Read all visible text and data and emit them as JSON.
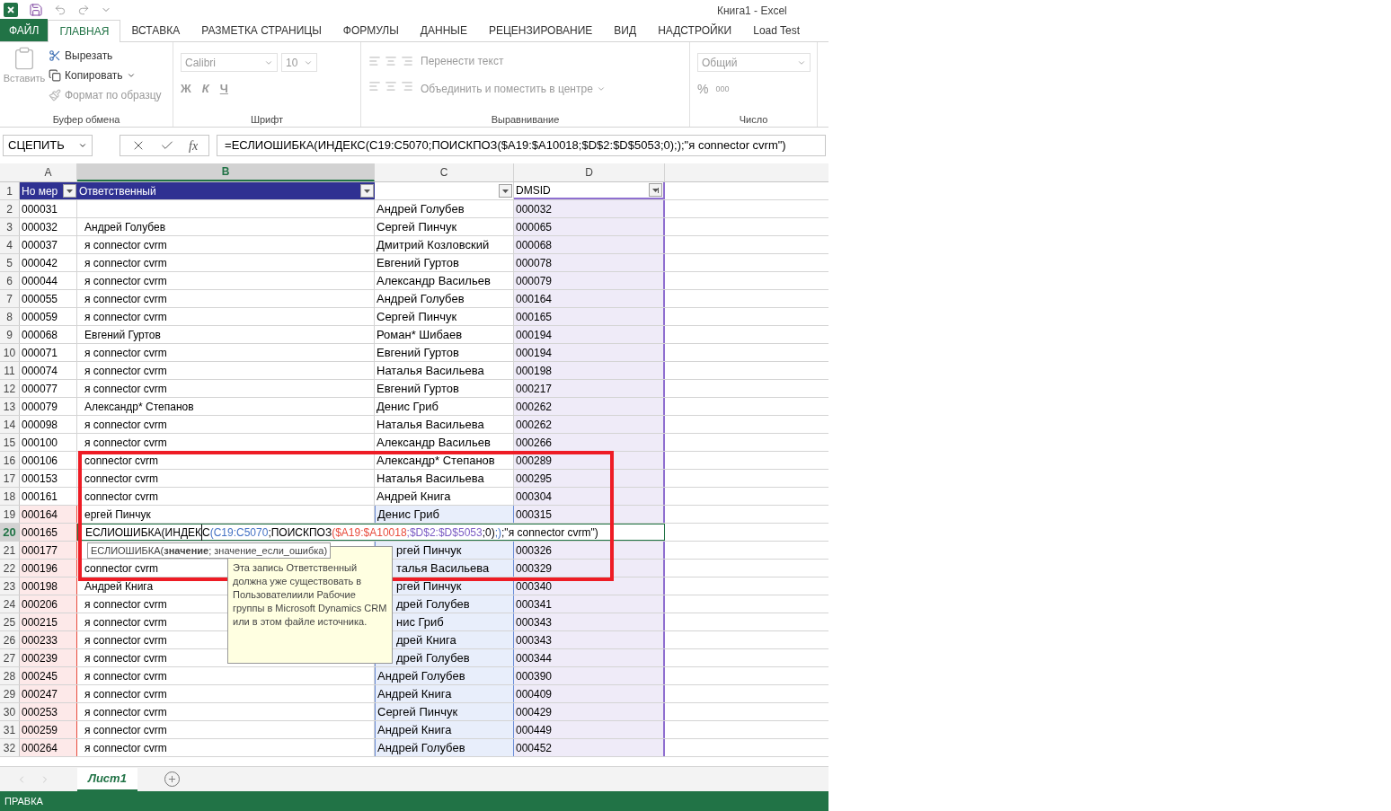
{
  "window": {
    "title": "Книга1 - Excel"
  },
  "tabs": [
    {
      "label": "ФАЙЛ",
      "kind": "file",
      "selected": false
    },
    {
      "label": "ГЛАВНАЯ",
      "kind": "tab",
      "selected": true
    },
    {
      "label": "ВСТАВКА",
      "kind": "tab",
      "selected": false
    },
    {
      "label": "РАЗМЕТКА СТРАНИЦЫ",
      "kind": "tab",
      "selected": false
    },
    {
      "label": "ФОРМУЛЫ",
      "kind": "tab",
      "selected": false
    },
    {
      "label": "ДАННЫЕ",
      "kind": "tab",
      "selected": false
    },
    {
      "label": "РЕЦЕНЗИРОВАНИЕ",
      "kind": "tab",
      "selected": false
    },
    {
      "label": "ВИД",
      "kind": "tab",
      "selected": false
    },
    {
      "label": "НАДСТРОЙКИ",
      "kind": "tab",
      "selected": false
    },
    {
      "label": "Load Test",
      "kind": "tab",
      "selected": false
    }
  ],
  "ribbon": {
    "disabled": true,
    "clipboard": {
      "paste": "Вставить",
      "cut": "Вырезать",
      "copy": "Копировать",
      "format_painter": "Формат по образцу",
      "label": "Буфер обмена"
    },
    "font": {
      "name": "Calibri",
      "size": "10",
      "bold": "Ж",
      "italic": "К",
      "underline": "Ч",
      "label": "Шрифт"
    },
    "alignment": {
      "wrap": "Перенести текст",
      "merge": "Объединить и поместить в центре",
      "label": "Выравнивание"
    },
    "number": {
      "format": "Общий",
      "percent": "%",
      "thousands": "000",
      "label": "Число"
    }
  },
  "formula_bar": {
    "name_box": "СЦЕПИТЬ",
    "fx": "fx",
    "formula": "=ЕСЛИОШИБКА(ИНДЕКС(C19:C5070;ПОИСКПОЗ($A19:$A10018;$D$2:$D$5053;0););\"я connector cvrm\")"
  },
  "columns": [
    {
      "label": "A",
      "selected": false
    },
    {
      "label": "B",
      "selected": true
    },
    {
      "label": "C",
      "selected": false
    },
    {
      "label": "D",
      "selected": false
    }
  ],
  "header_row": {
    "num": "1",
    "a": "Но мер",
    "b": "Ответственный",
    "d": "DMSID"
  },
  "rows": [
    {
      "num": "2",
      "a": "000031",
      "b": "",
      "c": "Андрей Голубев",
      "d": "000032",
      "a_ref": false,
      "c_ref": false,
      "d_ref": true
    },
    {
      "num": "3",
      "a": "000032",
      "b": "Андрей Голубев",
      "c": "Сергей Пинчук",
      "d": "000065",
      "a_ref": false,
      "c_ref": false,
      "d_ref": true
    },
    {
      "num": "4",
      "a": "000037",
      "b": "я connector cvrm",
      "c": "Дмитрий Козловский",
      "d": "000068",
      "a_ref": false,
      "c_ref": false,
      "d_ref": true
    },
    {
      "num": "5",
      "a": "000042",
      "b": "я connector cvrm",
      "c": "Евгений Гуртов",
      "d": "000078",
      "a_ref": false,
      "c_ref": false,
      "d_ref": true
    },
    {
      "num": "6",
      "a": "000044",
      "b": "я connector cvrm",
      "c": "Александр Васильев",
      "d": "000079",
      "a_ref": false,
      "c_ref": false,
      "d_ref": true
    },
    {
      "num": "7",
      "a": "000055",
      "b": "я connector cvrm",
      "c": "Андрей Голубев",
      "d": "000164",
      "a_ref": false,
      "c_ref": false,
      "d_ref": true
    },
    {
      "num": "8",
      "a": "000059",
      "b": "я connector cvrm",
      "c": "Сергей Пинчук",
      "d": "000165",
      "a_ref": false,
      "c_ref": false,
      "d_ref": true
    },
    {
      "num": "9",
      "a": "000068",
      "b": "Евгений Гуртов",
      "c": "Роман* Шибаев",
      "d": "000194",
      "a_ref": false,
      "c_ref": false,
      "d_ref": true
    },
    {
      "num": "10",
      "a": "000071",
      "b": "я connector cvrm",
      "c": "Евгений Гуртов",
      "d": "000194",
      "a_ref": false,
      "c_ref": false,
      "d_ref": true
    },
    {
      "num": "11",
      "a": "000074",
      "b": "я connector cvrm",
      "c": "Наталья Васильева",
      "d": "000198",
      "a_ref": false,
      "c_ref": false,
      "d_ref": true
    },
    {
      "num": "12",
      "a": "000077",
      "b": "я connector cvrm",
      "c": "Евгений Гуртов",
      "d": "000217",
      "a_ref": false,
      "c_ref": false,
      "d_ref": true
    },
    {
      "num": "13",
      "a": "000079",
      "b": "Александр* Степанов",
      "c": "Денис Гриб",
      "d": "000262",
      "a_ref": false,
      "c_ref": false,
      "d_ref": true
    },
    {
      "num": "14",
      "a": "000098",
      "b": "я connector cvrm",
      "c": "Наталья Васильева",
      "d": "000262",
      "a_ref": false,
      "c_ref": false,
      "d_ref": true
    },
    {
      "num": "15",
      "a": "000100",
      "b": "я connector cvrm",
      "c": "Александр Васильев",
      "d": "000266",
      "a_ref": false,
      "c_ref": false,
      "d_ref": true
    },
    {
      "num": "16",
      "a": "000106",
      "b": "connector cvrm",
      "c": "Александр* Степанов",
      "d": "000289",
      "a_ref": false,
      "c_ref": false,
      "d_ref": true
    },
    {
      "num": "17",
      "a": "000153",
      "b": "connector cvrm",
      "c": "Наталья Васильева",
      "d": "000295",
      "a_ref": false,
      "c_ref": false,
      "d_ref": true
    },
    {
      "num": "18",
      "a": "000161",
      "b": "connector cvrm",
      "c": "Андрей Книга",
      "d": "000304",
      "a_ref": false,
      "c_ref": false,
      "d_ref": true
    },
    {
      "num": "19",
      "a": "000164",
      "b": "ергей Пинчук",
      "c": "Денис Гриб",
      "d": "000315",
      "a_ref": true,
      "c_ref": true,
      "d_ref": true
    },
    {
      "num": "20",
      "kind": "editing",
      "a": "000165",
      "a_ref": true,
      "segments": [
        {
          "text": "ЕСЛИОШИБКА(ИНДЕК",
          "color": "#000000"
        },
        {
          "text": "С",
          "color": "#000000"
        },
        {
          "text": "(C19:C5070",
          "color": "#4472c4"
        },
        {
          "text": ";ПОИСКПОЗ",
          "color": "#000000"
        },
        {
          "text": "($A19:$A10018",
          "color": "#e84c3d"
        },
        {
          "text": ";$D$2:$D$5053",
          "color": "#7b5cc4"
        },
        {
          "text": ";0)",
          "color": "#000000"
        },
        {
          "text": ";)",
          "color": "#4472c4"
        },
        {
          "text": ";\"я connector cvrm\")",
          "color": "#000000"
        }
      ]
    },
    {
      "num": "21",
      "a": "000177",
      "b": "",
      "c": "ргей Пинчук",
      "d": "000326",
      "a_ref": true,
      "c_ref": true,
      "d_ref": true,
      "c_partly_hidden": true
    },
    {
      "num": "22",
      "a": "000196",
      "b": "connector cvrm",
      "c": "талья Васильева",
      "d": "000329",
      "a_ref": true,
      "c_ref": true,
      "d_ref": true,
      "c_partly_hidden": true
    },
    {
      "num": "23",
      "a": "000198",
      "b": "Андрей Книга",
      "c": "ргей Пинчук",
      "d": "000340",
      "a_ref": true,
      "c_ref": true,
      "d_ref": true,
      "c_partly_hidden": true
    },
    {
      "num": "24",
      "a": "000206",
      "b": "я connector cvrm",
      "c": "дрей Голубев",
      "d": "000341",
      "a_ref": true,
      "c_ref": true,
      "d_ref": true,
      "c_partly_hidden": true
    },
    {
      "num": "25",
      "a": "000215",
      "b": "я connector cvrm",
      "c": "нис Гриб",
      "d": "000343",
      "a_ref": true,
      "c_ref": true,
      "d_ref": true,
      "c_partly_hidden": true
    },
    {
      "num": "26",
      "a": "000233",
      "b": "я connector cvrm",
      "c": "дрей Книга",
      "d": "000343",
      "a_ref": true,
      "c_ref": true,
      "d_ref": true,
      "c_partly_hidden": true
    },
    {
      "num": "27",
      "a": "000239",
      "b": "я connector cvrm",
      "c": "дрей Голубев",
      "d": "000344",
      "a_ref": true,
      "c_ref": true,
      "d_ref": true,
      "c_partly_hidden": true
    },
    {
      "num": "28",
      "a": "000245",
      "b": "я connector cvrm",
      "c": "Андрей Голубев",
      "d": "000390",
      "a_ref": true,
      "c_ref": true,
      "d_ref": true
    },
    {
      "num": "29",
      "a": "000247",
      "b": "я connector cvrm",
      "c": "Андрей Книга",
      "d": "000409",
      "a_ref": true,
      "c_ref": true,
      "d_ref": true
    },
    {
      "num": "30",
      "a": "000253",
      "b": "я connector cvrm",
      "c": "Сергей Пинчук",
      "d": "000429",
      "a_ref": true,
      "c_ref": true,
      "d_ref": true
    },
    {
      "num": "31",
      "a": "000259",
      "b": "я connector cvrm",
      "c": "Андрей Книга",
      "d": "000449",
      "a_ref": true,
      "c_ref": true,
      "d_ref": true
    },
    {
      "num": "32",
      "a": "000264",
      "b": "я connector cvrm",
      "c": "Андрей Голубев",
      "d": "000452",
      "a_ref": true,
      "c_ref": true,
      "d_ref": true
    }
  ],
  "function_hint": "ЕСЛИОШИБКА(**значение**; значение_если_ошибка)",
  "tooltip": "Эта запись Ответственный должна уже существовать в Пользователиили Рабочие группы в Microsoft Dynamics CRM или в этом файле источника.",
  "sheets": [
    {
      "label": "Лист1",
      "selected": true
    }
  ],
  "status_bar": {
    "mode": "ПРАВКА"
  }
}
